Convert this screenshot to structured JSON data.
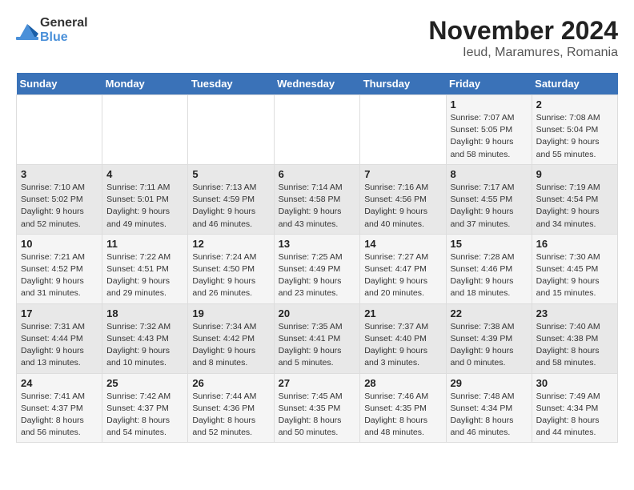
{
  "logo": {
    "text_general": "General",
    "text_blue": "Blue"
  },
  "header": {
    "month": "November 2024",
    "location": "Ieud, Maramures, Romania"
  },
  "weekdays": [
    "Sunday",
    "Monday",
    "Tuesday",
    "Wednesday",
    "Thursday",
    "Friday",
    "Saturday"
  ],
  "weeks": [
    [
      {
        "day": "",
        "info": ""
      },
      {
        "day": "",
        "info": ""
      },
      {
        "day": "",
        "info": ""
      },
      {
        "day": "",
        "info": ""
      },
      {
        "day": "",
        "info": ""
      },
      {
        "day": "1",
        "info": "Sunrise: 7:07 AM\nSunset: 5:05 PM\nDaylight: 9 hours and 58 minutes."
      },
      {
        "day": "2",
        "info": "Sunrise: 7:08 AM\nSunset: 5:04 PM\nDaylight: 9 hours and 55 minutes."
      }
    ],
    [
      {
        "day": "3",
        "info": "Sunrise: 7:10 AM\nSunset: 5:02 PM\nDaylight: 9 hours and 52 minutes."
      },
      {
        "day": "4",
        "info": "Sunrise: 7:11 AM\nSunset: 5:01 PM\nDaylight: 9 hours and 49 minutes."
      },
      {
        "day": "5",
        "info": "Sunrise: 7:13 AM\nSunset: 4:59 PM\nDaylight: 9 hours and 46 minutes."
      },
      {
        "day": "6",
        "info": "Sunrise: 7:14 AM\nSunset: 4:58 PM\nDaylight: 9 hours and 43 minutes."
      },
      {
        "day": "7",
        "info": "Sunrise: 7:16 AM\nSunset: 4:56 PM\nDaylight: 9 hours and 40 minutes."
      },
      {
        "day": "8",
        "info": "Sunrise: 7:17 AM\nSunset: 4:55 PM\nDaylight: 9 hours and 37 minutes."
      },
      {
        "day": "9",
        "info": "Sunrise: 7:19 AM\nSunset: 4:54 PM\nDaylight: 9 hours and 34 minutes."
      }
    ],
    [
      {
        "day": "10",
        "info": "Sunrise: 7:21 AM\nSunset: 4:52 PM\nDaylight: 9 hours and 31 minutes."
      },
      {
        "day": "11",
        "info": "Sunrise: 7:22 AM\nSunset: 4:51 PM\nDaylight: 9 hours and 29 minutes."
      },
      {
        "day": "12",
        "info": "Sunrise: 7:24 AM\nSunset: 4:50 PM\nDaylight: 9 hours and 26 minutes."
      },
      {
        "day": "13",
        "info": "Sunrise: 7:25 AM\nSunset: 4:49 PM\nDaylight: 9 hours and 23 minutes."
      },
      {
        "day": "14",
        "info": "Sunrise: 7:27 AM\nSunset: 4:47 PM\nDaylight: 9 hours and 20 minutes."
      },
      {
        "day": "15",
        "info": "Sunrise: 7:28 AM\nSunset: 4:46 PM\nDaylight: 9 hours and 18 minutes."
      },
      {
        "day": "16",
        "info": "Sunrise: 7:30 AM\nSunset: 4:45 PM\nDaylight: 9 hours and 15 minutes."
      }
    ],
    [
      {
        "day": "17",
        "info": "Sunrise: 7:31 AM\nSunset: 4:44 PM\nDaylight: 9 hours and 13 minutes."
      },
      {
        "day": "18",
        "info": "Sunrise: 7:32 AM\nSunset: 4:43 PM\nDaylight: 9 hours and 10 minutes."
      },
      {
        "day": "19",
        "info": "Sunrise: 7:34 AM\nSunset: 4:42 PM\nDaylight: 9 hours and 8 minutes."
      },
      {
        "day": "20",
        "info": "Sunrise: 7:35 AM\nSunset: 4:41 PM\nDaylight: 9 hours and 5 minutes."
      },
      {
        "day": "21",
        "info": "Sunrise: 7:37 AM\nSunset: 4:40 PM\nDaylight: 9 hours and 3 minutes."
      },
      {
        "day": "22",
        "info": "Sunrise: 7:38 AM\nSunset: 4:39 PM\nDaylight: 9 hours and 0 minutes."
      },
      {
        "day": "23",
        "info": "Sunrise: 7:40 AM\nSunset: 4:38 PM\nDaylight: 8 hours and 58 minutes."
      }
    ],
    [
      {
        "day": "24",
        "info": "Sunrise: 7:41 AM\nSunset: 4:37 PM\nDaylight: 8 hours and 56 minutes."
      },
      {
        "day": "25",
        "info": "Sunrise: 7:42 AM\nSunset: 4:37 PM\nDaylight: 8 hours and 54 minutes."
      },
      {
        "day": "26",
        "info": "Sunrise: 7:44 AM\nSunset: 4:36 PM\nDaylight: 8 hours and 52 minutes."
      },
      {
        "day": "27",
        "info": "Sunrise: 7:45 AM\nSunset: 4:35 PM\nDaylight: 8 hours and 50 minutes."
      },
      {
        "day": "28",
        "info": "Sunrise: 7:46 AM\nSunset: 4:35 PM\nDaylight: 8 hours and 48 minutes."
      },
      {
        "day": "29",
        "info": "Sunrise: 7:48 AM\nSunset: 4:34 PM\nDaylight: 8 hours and 46 minutes."
      },
      {
        "day": "30",
        "info": "Sunrise: 7:49 AM\nSunset: 4:34 PM\nDaylight: 8 hours and 44 minutes."
      }
    ]
  ]
}
